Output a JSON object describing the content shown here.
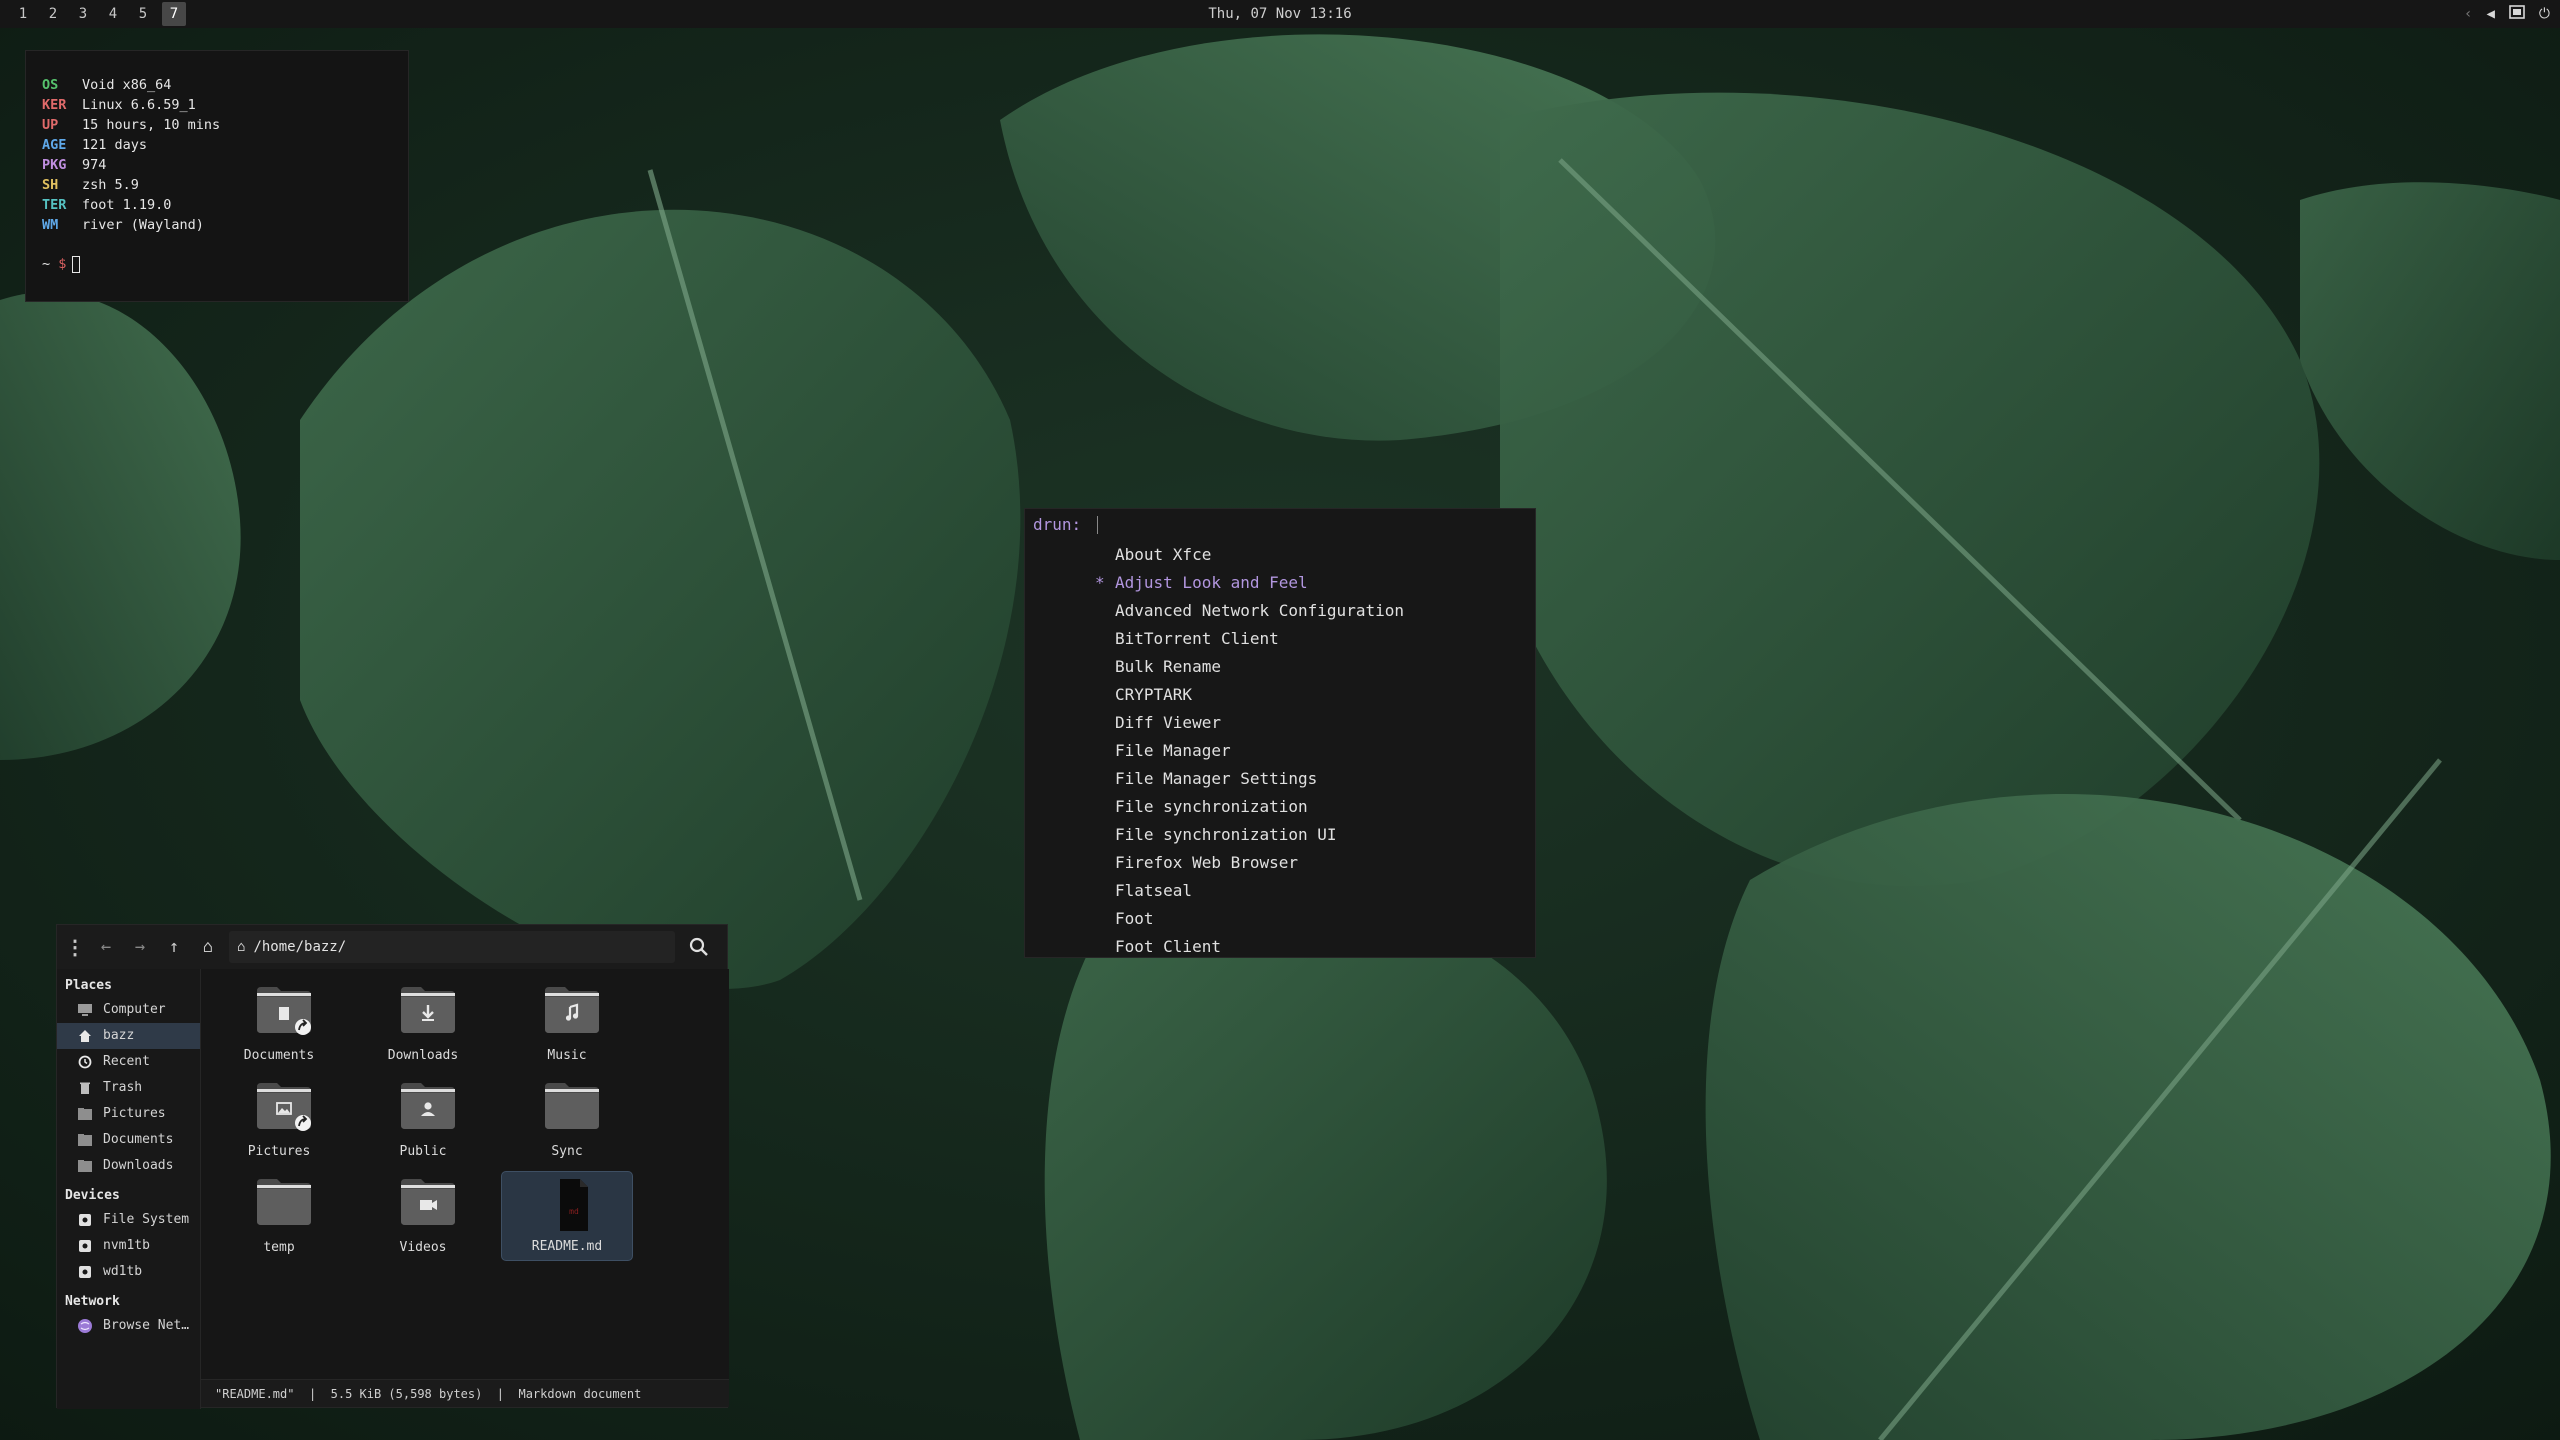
{
  "topbar": {
    "tags": [
      "1",
      "2",
      "3",
      "4",
      "5",
      "7"
    ],
    "active_tag": "7",
    "clock": "Thu, 07 Nov  13:16",
    "tray_icons": [
      "chevron-left-icon",
      "volume-icon",
      "network-icon",
      "power-icon"
    ],
    "tray_glyphs": {
      "chevron": "‹",
      "volume": "◀",
      "power": "⏻"
    }
  },
  "terminal": {
    "rows": [
      {
        "key": "OS",
        "value": "Void x86_64",
        "color": "#56c26d"
      },
      {
        "key": "KER",
        "value": "Linux 6.6.59_1",
        "color": "#e06a6a"
      },
      {
        "key": "UP",
        "value": "15 hours, 10 mins",
        "color": "#e06a6a"
      },
      {
        "key": "AGE",
        "value": "121 days",
        "color": "#5fa8e8"
      },
      {
        "key": "PKG",
        "value": "974",
        "color": "#c08fe0"
      },
      {
        "key": "SH",
        "value": "zsh 5.9",
        "color": "#e0c060"
      },
      {
        "key": "TER",
        "value": "foot 1.19.0",
        "color": "#56c2c2"
      },
      {
        "key": "WM",
        "value": "river (Wayland)",
        "color": "#5fa8e8"
      }
    ],
    "prompt_tilde": "~",
    "prompt_symbol": "$"
  },
  "launcher": {
    "prompt": "drun:",
    "selected_marker": "*",
    "items": [
      "About Xfce",
      "Adjust Look and Feel",
      "Advanced Network Configuration",
      "BitTorrent Client",
      "Bulk Rename",
      "CRYPTARK",
      "Diff Viewer",
      "File Manager",
      "File Manager Settings",
      "File synchronization",
      "File synchronization UI",
      "Firefox Web Browser",
      "Flatseal",
      "Foot",
      "Foot Client"
    ],
    "selected_index": 1,
    "accent": "#b296df"
  },
  "file_manager": {
    "path": "/home/bazz/",
    "toolbar_glyphs": {
      "menu": "⋮",
      "back": "←",
      "forward": "→",
      "up": "↑",
      "home": "⌂"
    },
    "sidebar": {
      "places_label": "Places",
      "places": [
        {
          "label": "Computer",
          "icon": "computer-icon"
        },
        {
          "label": "bazz",
          "icon": "home-icon",
          "active": true
        },
        {
          "label": "Recent",
          "icon": "clock-icon"
        },
        {
          "label": "Trash",
          "icon": "trash-icon"
        },
        {
          "label": "Pictures",
          "icon": "pictures-folder-icon"
        },
        {
          "label": "Documents",
          "icon": "documents-folder-icon"
        },
        {
          "label": "Downloads",
          "icon": "downloads-folder-icon"
        }
      ],
      "devices_label": "Devices",
      "devices": [
        {
          "label": "File System",
          "icon": "drive-icon"
        },
        {
          "label": "nvm1tb",
          "icon": "drive-icon"
        },
        {
          "label": "wd1tb",
          "icon": "drive-icon"
        }
      ],
      "network_label": "Network",
      "network": [
        {
          "label": "Browse Net…",
          "icon": "network-globe-icon"
        }
      ]
    },
    "items": [
      {
        "label": "Documents",
        "type": "folder",
        "emblem": "document",
        "link": true
      },
      {
        "label": "Downloads",
        "type": "folder",
        "emblem": "download"
      },
      {
        "label": "Music",
        "type": "folder",
        "emblem": "music"
      },
      {
        "label": "Pictures",
        "type": "folder",
        "emblem": "picture",
        "link": true
      },
      {
        "label": "Public",
        "type": "folder",
        "emblem": "person"
      },
      {
        "label": "Sync",
        "type": "folder",
        "emblem": "none"
      },
      {
        "label": "temp",
        "type": "folder",
        "emblem": "none"
      },
      {
        "label": "Videos",
        "type": "folder",
        "emblem": "video"
      },
      {
        "label": "README.md",
        "type": "file",
        "emblem": "markdown",
        "selected": true
      }
    ],
    "status": {
      "name": "\"README.md\"",
      "size": "5.5 KiB (5,598 bytes)",
      "type": "Markdown document",
      "separator": "|"
    }
  }
}
